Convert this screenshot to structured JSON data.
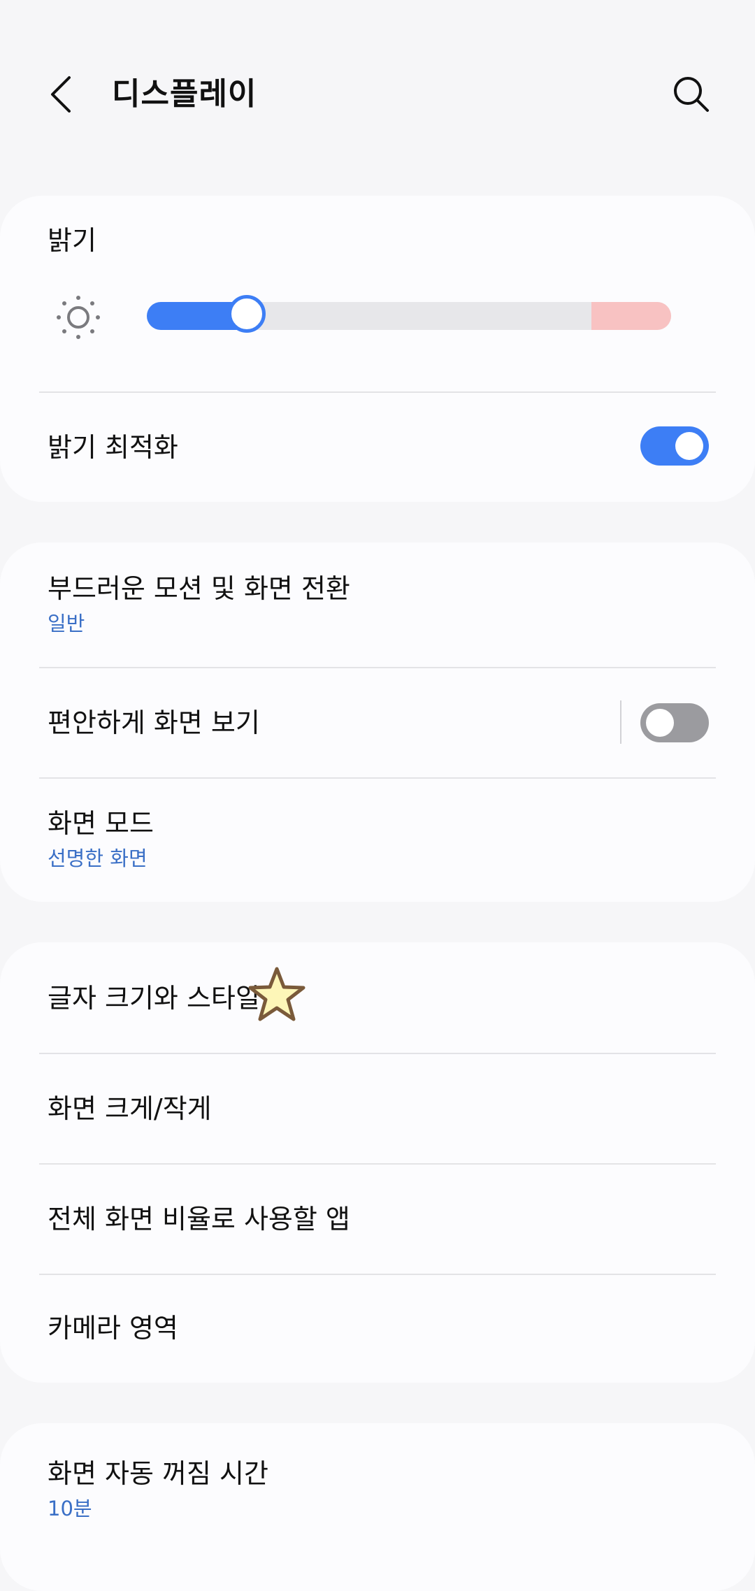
{
  "header": {
    "title": "디스플레이",
    "back_icon": "back-arrow-icon",
    "search_icon": "search-icon"
  },
  "brightness_card": {
    "brightness_label": "밝기",
    "brightness_level": 0.19,
    "sun_icon": "sun-icon",
    "adaptive_label": "밝기 최적화",
    "adaptive_on": true
  },
  "motion_card": {
    "motion_label": "부드러운 모션 및 화면 전환",
    "motion_value": "일반",
    "eye_comfort_label": "편안하게 화면 보기",
    "eye_comfort_on": false,
    "screen_mode_label": "화면 모드",
    "screen_mode_value": "선명한 화면"
  },
  "font_card": {
    "font_label": "글자 크기와 스타일",
    "star_icon": "star-icon",
    "zoom_label": "화면 크게/작게",
    "fullscreen_label": "전체 화면 비율로 사용할 앱",
    "camera_cutout_label": "카메라 영역"
  },
  "timeout_card": {
    "timeout_label": "화면 자동 꺼짐 시간",
    "timeout_value": "10분"
  },
  "colors": {
    "accent": "#3d7ef5",
    "subtitle": "#3a6fc6",
    "background": "#f6f6f8",
    "card": "#fcfcfe",
    "warn": "#f8c2c2"
  }
}
